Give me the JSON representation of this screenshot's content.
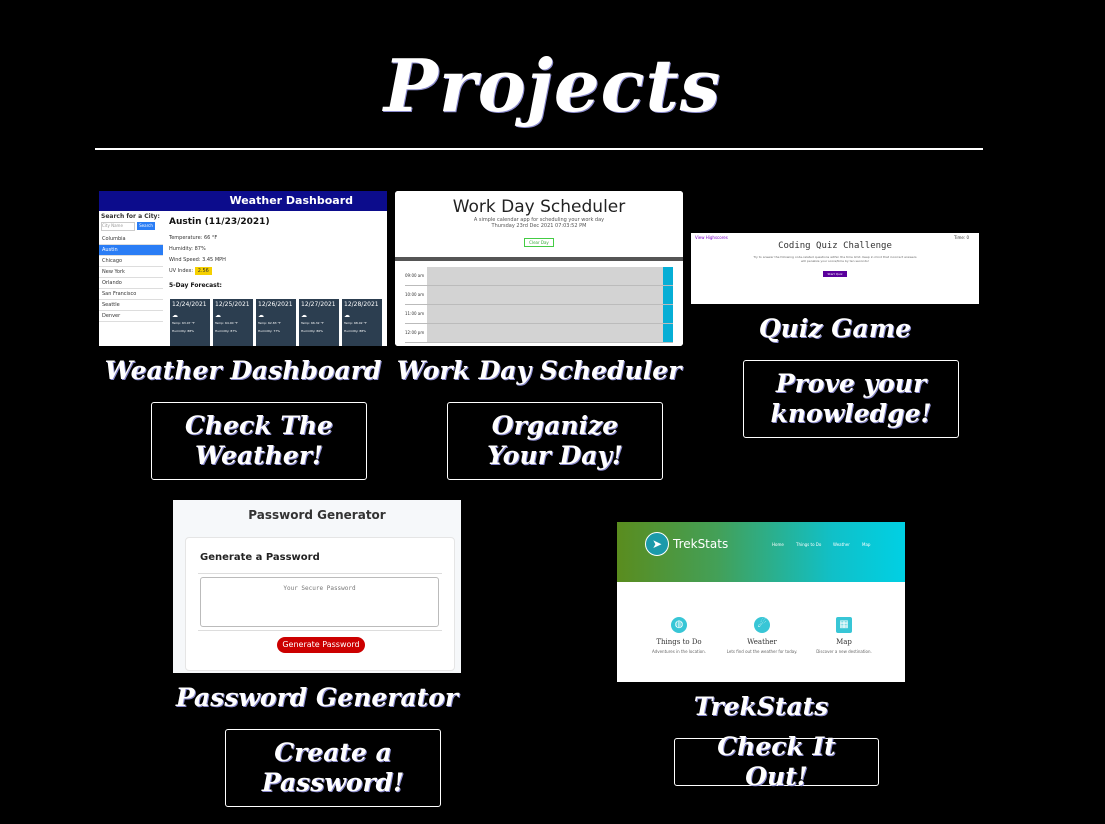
{
  "page": {
    "title": "Projects"
  },
  "projects": {
    "weather": {
      "name": "Weather Dashboard",
      "button": "Check The Weather!",
      "thumb": {
        "header": "Weather Dashboard",
        "search_label": "Search for a City:",
        "search_placeholder": "City Name",
        "search_button": "Search",
        "cities": [
          "Columbia",
          "Austin",
          "Chicago",
          "New York",
          "Orlando",
          "San Francisco",
          "Seattle",
          "Denver"
        ],
        "selected_city": "Austin",
        "current": "Austin (11/23/2021)",
        "temp": "Temperature: 66 °F",
        "humidity": "Humidity: 87%",
        "wind": "Wind Speed: 3.45 MPH",
        "uv_label": "UV Index:",
        "uv_value": "2.56",
        "forecast_title": "5-Day Forecast:",
        "forecast": [
          {
            "date": "12/24/2021",
            "temp": "Temp: 63.07 °F",
            "humidity": "Humidity: 88%"
          },
          {
            "date": "12/25/2021",
            "temp": "Temp: 64.00 °F",
            "humidity": "Humidity: 87%"
          },
          {
            "date": "12/26/2021",
            "temp": "Temp: 62.83 °F",
            "humidity": "Humidity: 77%"
          },
          {
            "date": "12/27/2021",
            "temp": "Temp: 66.32 °F",
            "humidity": "Humidity: 86%"
          },
          {
            "date": "12/28/2021",
            "temp": "Temp: 68.02 °F",
            "humidity": "Humidity: 88%"
          }
        ]
      }
    },
    "scheduler": {
      "name": "Work Day Scheduler",
      "button": "Organize Your Day!",
      "thumb": {
        "title": "Work Day Scheduler",
        "subtitle": "A simple calendar app for scheduling your work day",
        "date": "Thursday 23rd Dec 2021 07:03:52 PM",
        "clear": "Clear Day",
        "hours": [
          "09:00 am",
          "10:00 am",
          "11:00 am",
          "12:00 pm"
        ]
      }
    },
    "quiz": {
      "name": "Quiz Game",
      "button": "Prove your knowledge!",
      "thumb": {
        "highscores": "View Highscores",
        "score": "Time: 0",
        "title": "Coding Quiz Challenge",
        "text": "Try to answer the following code-related questions within the time limit. Keep in mind that incorrect answers will penalize your score/time by ten seconds!",
        "start": "Start Quiz"
      }
    },
    "password": {
      "name": "Password Generator",
      "button": "Create a Password!",
      "thumb": {
        "header": "Password Generator",
        "label": "Generate a Password",
        "placeholder": "Your Secure Password",
        "generate": "Generate Password"
      }
    },
    "trekstats": {
      "name": "TrekStats",
      "button": "Check It Out!",
      "thumb": {
        "brand": "TrekStats",
        "nav": [
          "Home",
          "Things to Do",
          "Weather",
          "Map"
        ],
        "features": [
          {
            "name": "Things to Do",
            "desc": "Adventures in the location."
          },
          {
            "name": "Weather",
            "desc": "Lets find out the weather for today."
          },
          {
            "name": "Map",
            "desc": "Discover a new destination."
          }
        ]
      }
    }
  }
}
